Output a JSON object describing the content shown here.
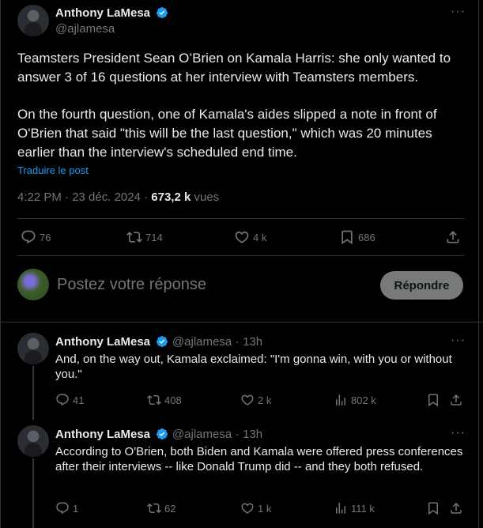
{
  "main_post": {
    "author_name": "Anthony LaMesa",
    "handle": "@ajlamesa",
    "more_label": "···",
    "paragraph1": "Teamsters President Sean O’Brien on Kamala Harris: she only wanted to answer 3 of 16 questions at her interview with Teamsters members.",
    "paragraph2": "On the fourth question, one of Kamala's aides slipped a note in front of O'Brien that said \"this will be the last question,\" which was 20 minutes earlier than the interview's scheduled end time.",
    "translate": "Traduire le post",
    "time": "4:22 PM · 23 déc. 2024 · ",
    "views_count": "673,2 k",
    "views_label": " vues",
    "replies": "76",
    "reposts": "714",
    "likes": "4 k",
    "bookmarks": "686"
  },
  "reply_box": {
    "placeholder": "Postez votre réponse",
    "button": "Répondre"
  },
  "replies": [
    {
      "author_name": "Anthony LaMesa",
      "handle": "@ajlamesa",
      "time": "13h",
      "text": "And, on the way out, Kamala exclaimed: \"I'm gonna win, with you or without you.\"",
      "replies": "41",
      "reposts": "408",
      "likes": "2 k",
      "views": "802 k"
    },
    {
      "author_name": "Anthony LaMesa",
      "handle": "@ajlamesa",
      "time": "13h",
      "text": "According to O'Brien, both Biden and Kamala were offered press conferences after their interviews -- like Donald Trump did -- and they both refused.",
      "replies": "1",
      "reposts": "62",
      "likes": "1 k",
      "views": "111 k"
    }
  ],
  "colors": {
    "background": "#000000",
    "text": "#e7e9ea",
    "muted": "#71767b",
    "accent": "#1d9bf0",
    "divider": "#2f3336"
  }
}
